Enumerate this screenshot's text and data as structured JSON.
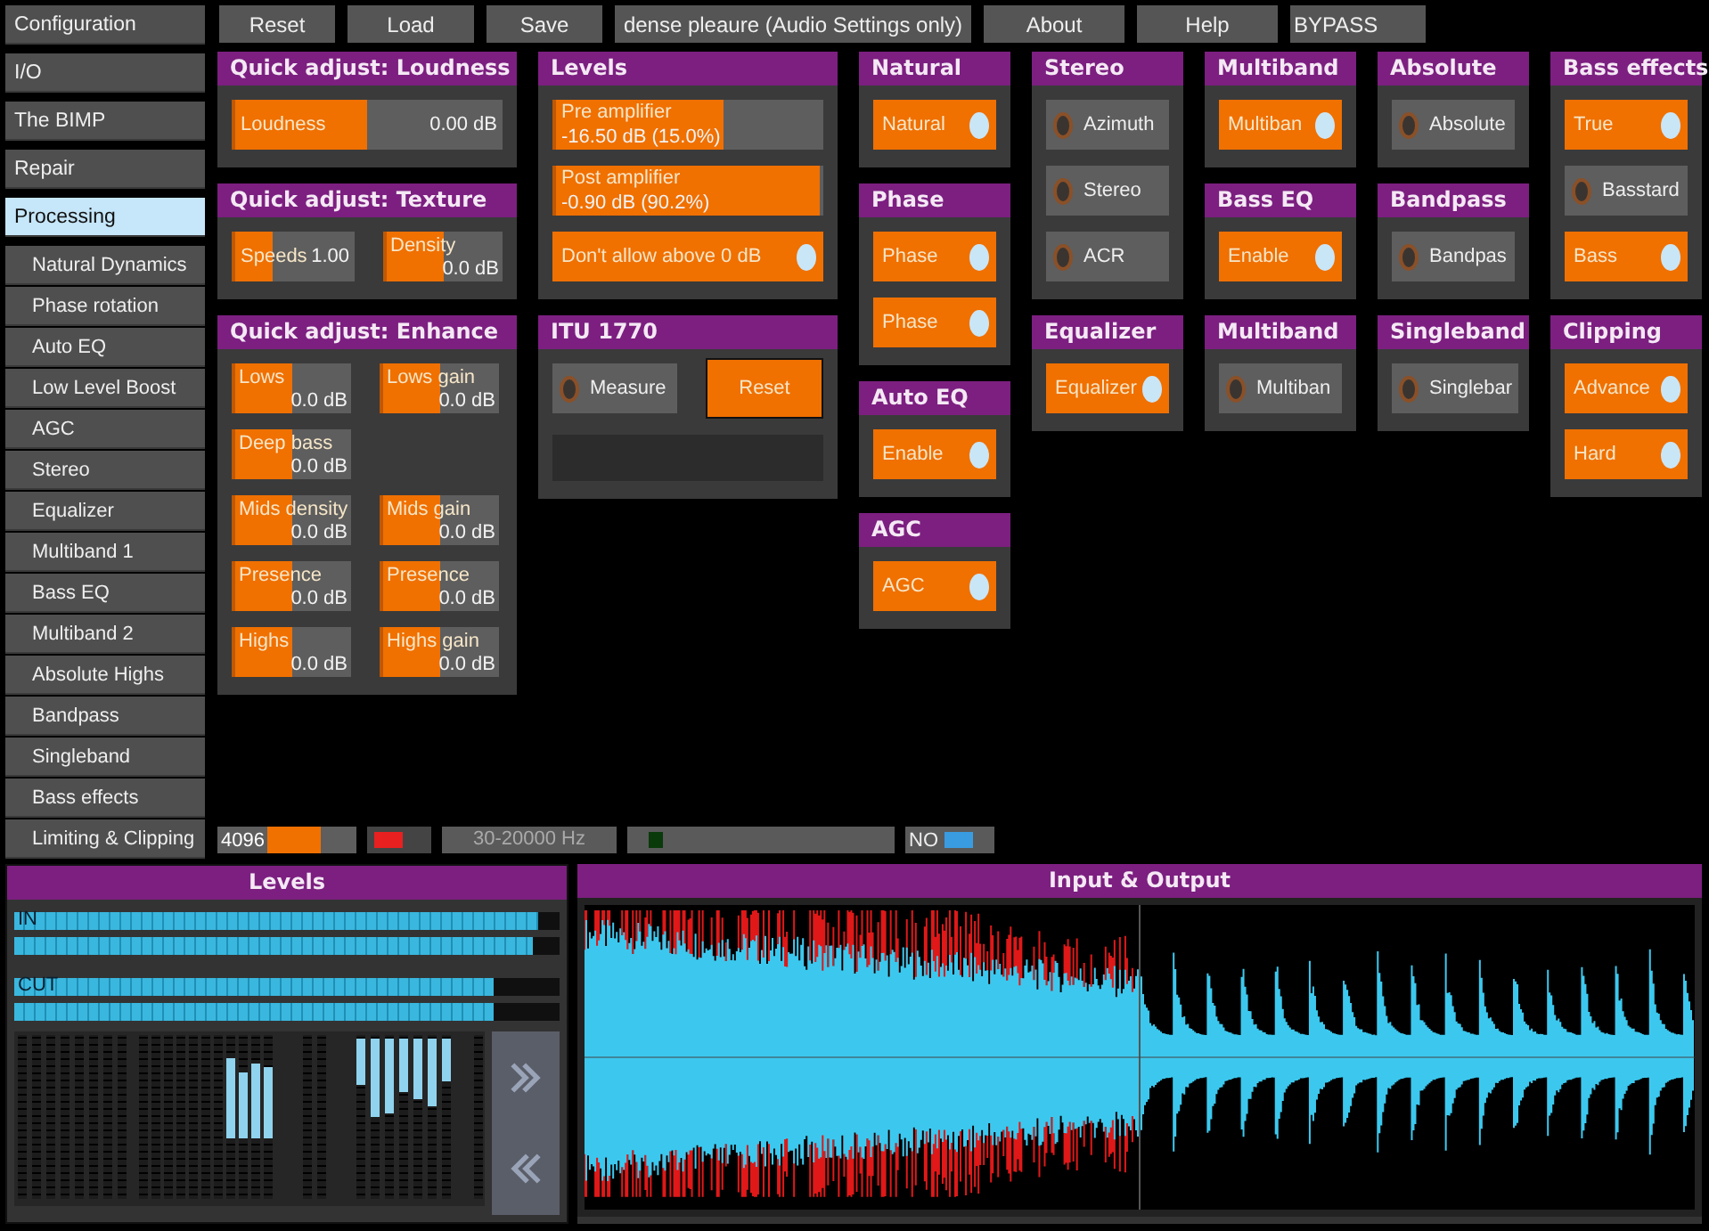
{
  "sidebar": {
    "items": [
      {
        "label": "Configuration",
        "kind": "section",
        "selected": false
      },
      {
        "label": "I/O",
        "kind": "section",
        "selected": false
      },
      {
        "label": "The BIMP",
        "kind": "section",
        "selected": false
      },
      {
        "label": "Repair",
        "kind": "section",
        "selected": false
      },
      {
        "label": "Processing",
        "kind": "section",
        "selected": true
      },
      {
        "label": "Natural Dynamics",
        "kind": "sub",
        "selected": false
      },
      {
        "label": "Phase rotation",
        "kind": "sub",
        "selected": false
      },
      {
        "label": "Auto EQ",
        "kind": "sub",
        "selected": false
      },
      {
        "label": "Low Level Boost",
        "kind": "sub",
        "selected": false
      },
      {
        "label": "AGC",
        "kind": "sub",
        "selected": false
      },
      {
        "label": "Stereo",
        "kind": "sub",
        "selected": false
      },
      {
        "label": "Equalizer",
        "kind": "sub",
        "selected": false
      },
      {
        "label": "Multiband 1",
        "kind": "sub",
        "selected": false
      },
      {
        "label": "Bass EQ",
        "kind": "sub",
        "selected": false
      },
      {
        "label": "Multiband 2",
        "kind": "sub",
        "selected": false
      },
      {
        "label": "Absolute Highs",
        "kind": "sub",
        "selected": false
      },
      {
        "label": "Bandpass",
        "kind": "sub",
        "selected": false
      },
      {
        "label": "Singleband",
        "kind": "sub",
        "selected": false
      },
      {
        "label": "Bass effects",
        "kind": "sub",
        "selected": false
      },
      {
        "label": "Limiting & Clipping",
        "kind": "sub",
        "selected": false
      }
    ]
  },
  "toolbar": {
    "buttons": [
      {
        "label": "Reset",
        "kind": "button"
      },
      {
        "label": "Load",
        "kind": "button"
      },
      {
        "label": "Save",
        "kind": "button"
      },
      {
        "label": "dense pleaure (Audio Settings only)",
        "kind": "preset"
      },
      {
        "label": "About",
        "kind": "button"
      },
      {
        "label": "Help",
        "kind": "button"
      },
      {
        "label": "BYPASS",
        "kind": "bypass"
      }
    ]
  },
  "columns": [
    [
      {
        "title": "Quick adjust: Loudness",
        "rows": [
          [
            {
              "kind": "slider",
              "label": "Loudness",
              "value": "0.00 dB",
              "level": 0.5
            }
          ]
        ]
      },
      {
        "title": "Quick adjust: Texture",
        "rows": [
          [
            {
              "kind": "slider",
              "label": "Speeds",
              "value": "1.00",
              "level": 0.33
            },
            {
              "kind": "stacked",
              "label": "Density",
              "value": "0.0 dB",
              "level": 0.5
            }
          ]
        ]
      },
      {
        "title": "Quick adjust: Enhance",
        "rows": [
          [
            {
              "kind": "stacked",
              "label": "Lows",
              "value": "0.0 dB",
              "level": 0.5
            },
            {
              "kind": "stacked",
              "label": "Lows gain",
              "value": "0.0 dB",
              "level": 0.5
            }
          ],
          [
            {
              "kind": "stacked",
              "label": "Deep bass",
              "value": "0.0 dB",
              "level": 0.5
            }
          ],
          [
            {
              "kind": "stacked",
              "label": "Mids density",
              "value": "0.0 dB",
              "level": 0.5
            },
            {
              "kind": "stacked",
              "label": "Mids gain",
              "value": "0.0 dB",
              "level": 0.5
            }
          ],
          [
            {
              "kind": "stacked",
              "label": "Presence",
              "value": "0.0 dB",
              "level": 0.5
            },
            {
              "kind": "stacked",
              "label": "Presence",
              "value": "0.0 dB",
              "level": 0.5
            }
          ],
          [
            {
              "kind": "stacked",
              "label": "Highs",
              "value": "0.0 dB",
              "level": 0.5
            },
            {
              "kind": "stacked",
              "label": "Highs gain",
              "value": "0.0 dB",
              "level": 0.5
            }
          ]
        ]
      }
    ],
    [
      {
        "title": "Levels",
        "rows": [
          [
            {
              "kind": "slider",
              "label": "Pre amplifier",
              "value": "-16.50 dB (15.0%)",
              "level": 0.63
            }
          ],
          [
            {
              "kind": "slider",
              "label": "Post amplifier",
              "value": "-0.90 dB (90.2%)",
              "level": 0.99
            }
          ],
          [
            {
              "kind": "toggle",
              "label": "Don't allow above 0 dB",
              "on": true
            }
          ]
        ]
      },
      {
        "title": "ITU 1770",
        "rows": [
          [
            {
              "kind": "toggle",
              "label": "Measure",
              "on": false
            },
            {
              "kind": "button",
              "label": "Reset"
            }
          ],
          [
            {
              "kind": "display"
            }
          ]
        ]
      }
    ],
    [
      {
        "title": "Natural",
        "rows": [
          [
            {
              "kind": "toggle",
              "label": "Natural",
              "on": true
            }
          ]
        ]
      },
      {
        "title": "Phase",
        "rows": [
          [
            {
              "kind": "toggle",
              "label": "Phase",
              "on": true
            }
          ],
          [
            {
              "kind": "toggle",
              "label": "Phase",
              "on": true
            }
          ]
        ]
      },
      {
        "title": "Auto EQ",
        "rows": [
          [
            {
              "kind": "toggle",
              "label": "Enable",
              "on": true
            }
          ]
        ]
      },
      {
        "title": "AGC",
        "rows": [
          [
            {
              "kind": "toggle",
              "label": "AGC",
              "on": true
            }
          ]
        ]
      }
    ],
    [
      {
        "title": "Stereo",
        "rows": [
          [
            {
              "kind": "toggle",
              "label": "Azimuth",
              "on": false
            }
          ],
          [
            {
              "kind": "toggle",
              "label": "Stereo",
              "on": false
            }
          ],
          [
            {
              "kind": "toggle",
              "label": "ACR",
              "on": false
            }
          ]
        ]
      },
      {
        "title": "Equalizer",
        "rows": [
          [
            {
              "kind": "toggle",
              "label": "Equalizer",
              "on": true
            }
          ]
        ]
      }
    ],
    [
      {
        "title": "Multiband",
        "rows": [
          [
            {
              "kind": "toggle",
              "label": "Multiban",
              "on": true
            }
          ]
        ]
      },
      {
        "title": "Bass EQ",
        "rows": [
          [
            {
              "kind": "toggle",
              "label": "Enable",
              "on": true
            }
          ]
        ]
      },
      {
        "title": "Multiband",
        "rows": [
          [
            {
              "kind": "toggle",
              "label": "Multiban",
              "on": false
            }
          ]
        ]
      }
    ],
    [
      {
        "title": "Absolute",
        "rows": [
          [
            {
              "kind": "toggle",
              "label": "Absolute",
              "on": false
            }
          ]
        ]
      },
      {
        "title": "Bandpass",
        "rows": [
          [
            {
              "kind": "toggle",
              "label": "Bandpas",
              "on": false
            }
          ]
        ]
      },
      {
        "title": "Singleband",
        "rows": [
          [
            {
              "kind": "toggle",
              "label": "Singlebar",
              "on": false
            }
          ]
        ]
      }
    ],
    [
      {
        "title": "Bass effects",
        "rows": [
          [
            {
              "kind": "toggle",
              "label": "True",
              "on": true
            }
          ],
          [
            {
              "kind": "toggle",
              "label": "Basstard",
              "on": false
            }
          ],
          [
            {
              "kind": "toggle",
              "label": "Bass",
              "on": true
            }
          ]
        ]
      },
      {
        "title": "Clipping",
        "rows": [
          [
            {
              "kind": "toggle",
              "label": "Advance",
              "on": true
            }
          ],
          [
            {
              "kind": "toggle",
              "label": "Hard",
              "on": true
            }
          ]
        ]
      }
    ]
  ],
  "status_bar": {
    "buffer": {
      "label": "4096",
      "level": 0.6
    },
    "clip_indicator": {
      "on": true
    },
    "frequency_range": "30-20000 Hz",
    "signal_indicator": {
      "on": false
    },
    "mode": {
      "label": "NO",
      "on": true
    }
  },
  "levels_panel": {
    "title": "Levels",
    "meters": [
      {
        "label": "IN",
        "level": 0.96
      },
      {
        "level": 0.95
      },
      {
        "label": "CUT",
        "level": 0.88
      },
      {
        "level": 0.88
      }
    ]
  },
  "io_panel": {
    "title": "Input & Output"
  }
}
